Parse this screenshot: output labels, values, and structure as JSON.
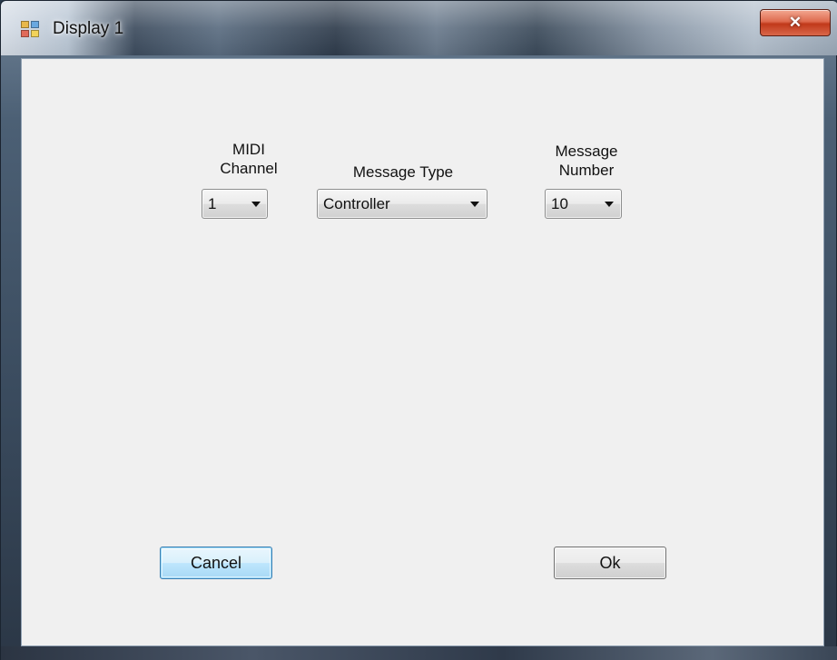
{
  "window": {
    "title": "Display 1",
    "close_glyph": "✕",
    "icon": "app-window-icon"
  },
  "fields": {
    "midi_channel": {
      "label_line1": "MIDI",
      "label_line2": "Channel",
      "value": "1"
    },
    "message_type": {
      "label": "Message Type",
      "value": "Controller"
    },
    "message_number": {
      "label_line1": "Message",
      "label_line2": "Number",
      "value": "10"
    }
  },
  "buttons": {
    "cancel": "Cancel",
    "ok": "Ok"
  },
  "colors": {
    "client_background": "#f0f0f0",
    "close_button": "#c1391a",
    "focused_button_border": "#3c7fb1"
  }
}
